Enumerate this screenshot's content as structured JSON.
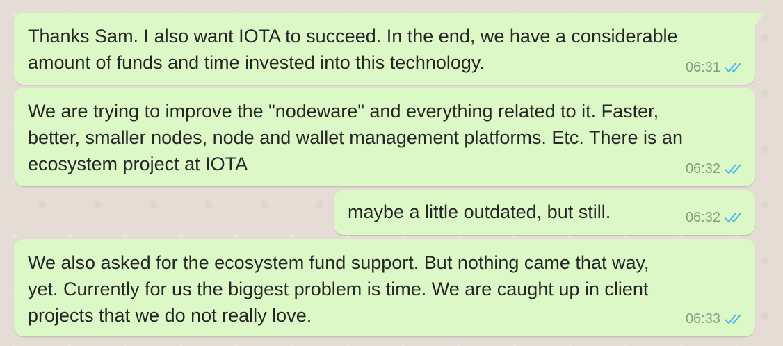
{
  "messages": [
    {
      "lines": [
        "Thanks Sam. I also want IOTA to succeed. In the end, we have a considerable",
        "amount of funds and time invested into this technology."
      ],
      "time": "06:31",
      "status": "read"
    },
    {
      "lines": [
        "We are trying to improve the \"nodeware\" and everything related to it. Faster,",
        "better, smaller nodes, node and wallet management platforms. Etc. There is an",
        "ecosystem project at IOTA"
      ],
      "time": "06:32",
      "status": "read"
    },
    {
      "lines": [
        "maybe a little outdated, but still."
      ],
      "time": "06:32",
      "status": "read"
    },
    {
      "lines": [
        "We also asked for the ecosystem fund support. But nothing came that way,",
        "yet. Currently for us the biggest problem is time. We are caught up in client",
        "projects that we do not really love."
      ],
      "time": "06:33",
      "status": "read"
    }
  ],
  "colors": {
    "bubble": "#dcf8c6",
    "read_ticks": "#4fb6ec",
    "background": "#e5ddd5"
  }
}
